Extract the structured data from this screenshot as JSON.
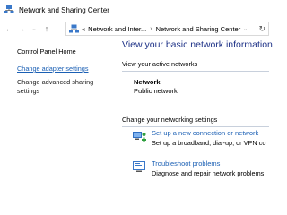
{
  "window": {
    "title": "Network and Sharing Center"
  },
  "address": {
    "overflow": "«",
    "crumbs": [
      "Network and Inter...",
      "Network and Sharing Center"
    ]
  },
  "sidebar": {
    "items": [
      {
        "label": "Control Panel Home"
      },
      {
        "label": "Change adapter settings"
      },
      {
        "label": "Change advanced sharing settings"
      }
    ]
  },
  "main": {
    "title": "View your basic network information",
    "active_networks_label": "View your active networks",
    "network": {
      "name": "Network",
      "type": "Public network"
    },
    "change_settings_label": "Change your networking settings",
    "tasks": [
      {
        "link": "Set up a new connection or network",
        "desc": "Set up a broadband, dial-up, or VPN co",
        "icon": "network-setup-icon"
      },
      {
        "link": "Troubleshoot problems",
        "desc": "Diagnose and repair network problems,",
        "icon": "troubleshoot-icon"
      }
    ]
  },
  "colors": {
    "link": "#1a5fb4",
    "heading": "#1e3287"
  }
}
